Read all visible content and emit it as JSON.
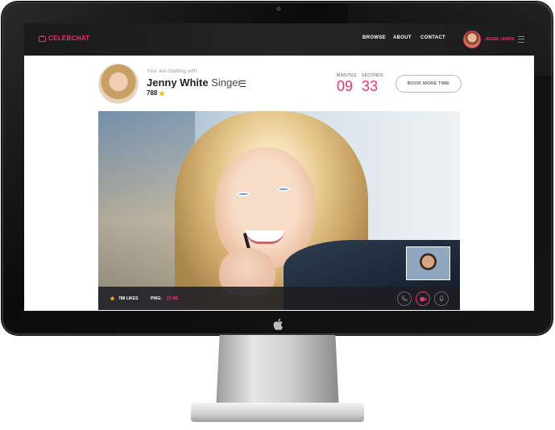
{
  "brand": {
    "name": "CELEBCHAT",
    "accent": "#e8336d"
  },
  "nav": {
    "links": [
      "BROWSE",
      "ABOUT",
      "CONTACT"
    ],
    "user_name": "JESSIE JAMES"
  },
  "celebrity": {
    "intro": "Your are chatting with",
    "first_name": "Jenny White",
    "role": "Singer",
    "rating": "788"
  },
  "timer": {
    "minutes_label": "MINUTES",
    "minutes": "09",
    "seconds_label": "SECONDS",
    "seconds": "33"
  },
  "book_button": "BOOK MORE TIME",
  "video_bar": {
    "likes": "788 LIKES",
    "ping_label": "PING:",
    "ping_value": "23 MS"
  },
  "icons": [
    "tv-icon",
    "menu-icon",
    "star-icon",
    "phone-icon",
    "video-camera-icon",
    "microphone-icon",
    "apple-logo-icon"
  ]
}
